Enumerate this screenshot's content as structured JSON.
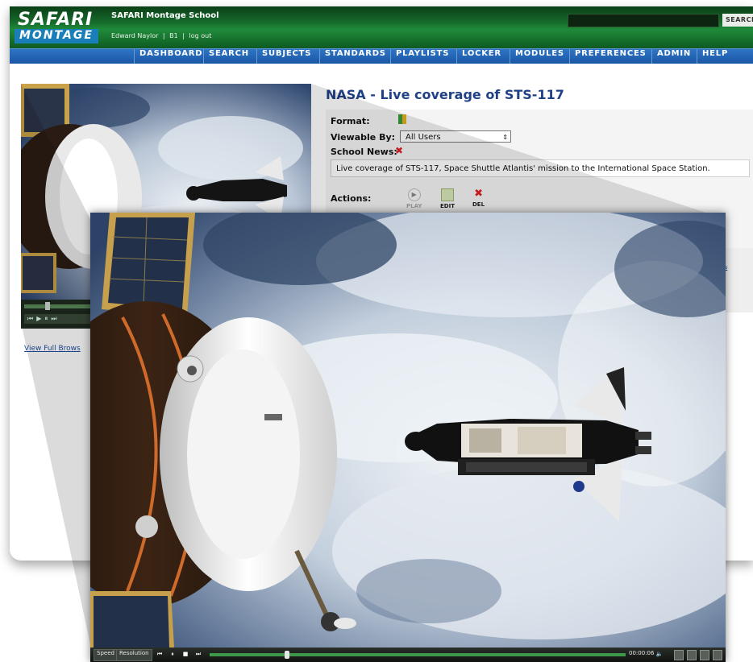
{
  "brand": {
    "logo_top": "SAFARI",
    "logo_bottom": "MONTAGE",
    "school_name": "SAFARI Montage School",
    "user_name": "Edward Naylor",
    "separator": "|",
    "user_code": "B1",
    "logout": "log out",
    "accent_green": "#1f8a3a",
    "nav_blue": "#1a56a6"
  },
  "header": {
    "search_label": "SEARCH"
  },
  "nav": {
    "items": [
      "DASHBOARD",
      "SEARCH",
      "SUBJECTS",
      "STANDARDS",
      "PLAYLISTS",
      "LOCKER",
      "MODULES",
      "PREFERENCES",
      "ADMIN",
      "HELP"
    ]
  },
  "video_page": {
    "title": "NASA - Live coverage of STS-117",
    "format_label": "Format:",
    "viewable_label": "Viewable By:",
    "viewable_value": "All Users",
    "school_news_label": "School News:",
    "description": "Live coverage of STS-117, Space Shuttle Atlantis' mission to the International Space Station.",
    "actions_label": "Actions:",
    "actions": {
      "play": "PLAY",
      "edit": "EDIT",
      "delete": "DEL"
    },
    "view_full_link": "View Full Brows",
    "side_link": "cts"
  },
  "player": {
    "speed_label": "Speed",
    "resolution_label": "Resolution",
    "time": "00:00:06",
    "progress_fraction": 0.18
  }
}
